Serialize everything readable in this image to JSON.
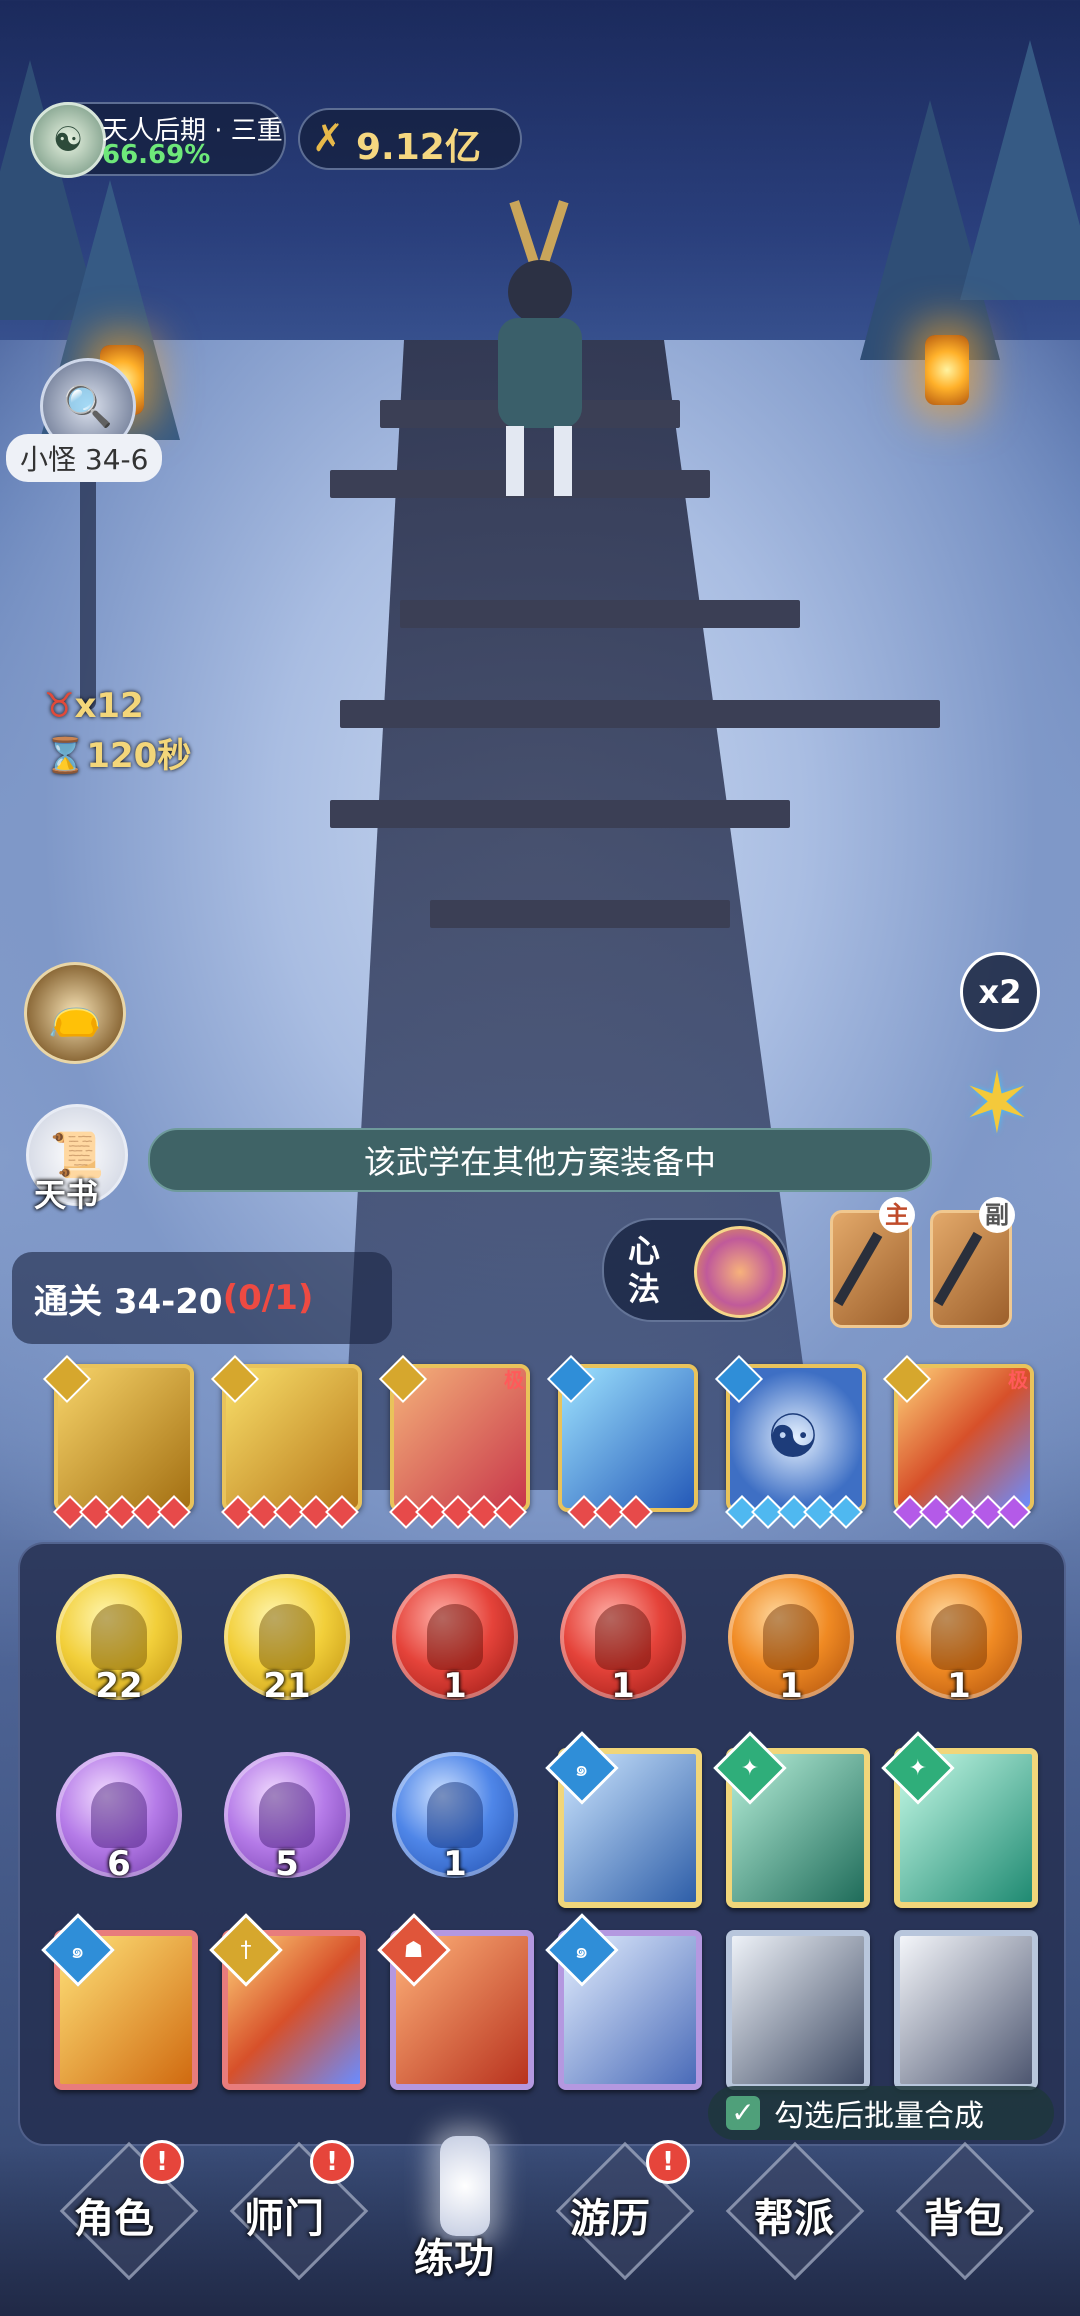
{
  "top": {
    "realm_label": "天人后期 · 三重",
    "realm_percent": "66.69%",
    "power_value": "9.12亿"
  },
  "left": {
    "search_label": "小怪 34-6",
    "enemy_count": "x12",
    "timer": "120秒",
    "tianshu_label": "天书"
  },
  "right": {
    "speed_label": "x2"
  },
  "banner_text": "该武学在其他方案装备中",
  "progress": {
    "label": "通关 34-20",
    "count": "(0/1)"
  },
  "xinfa": {
    "label": "心法"
  },
  "weapons": {
    "main_tag": "主",
    "sub_tag": "副"
  },
  "skill_cards": [
    {
      "tag": ""
    },
    {
      "tag": ""
    },
    {
      "tag": "极"
    },
    {
      "tag": ""
    },
    {
      "tag": ""
    },
    {
      "tag": "极"
    }
  ],
  "inventory": {
    "orbs": [
      {
        "count": "22",
        "color": "#f2cf3a"
      },
      {
        "count": "21",
        "color": "#f2cf3a"
      },
      {
        "count": "1",
        "color": "#e5433a"
      },
      {
        "count": "1",
        "color": "#e5433a"
      },
      {
        "count": "1",
        "color": "#f08a23"
      },
      {
        "count": "1",
        "color": "#f08a23"
      },
      {
        "count": "6",
        "color": "#b57be8"
      },
      {
        "count": "5",
        "color": "#b57be8"
      },
      {
        "count": "1",
        "color": "#4f86e8"
      }
    ],
    "batch_label": "勾选后批量合成"
  },
  "nav": {
    "items": [
      {
        "label": "角色",
        "alert": "!"
      },
      {
        "label": "师门",
        "alert": "!"
      },
      {
        "label": "练功",
        "alert": ""
      },
      {
        "label": "游历",
        "alert": "!"
      },
      {
        "label": "帮派",
        "alert": ""
      },
      {
        "label": "背包",
        "alert": ""
      }
    ]
  },
  "icons": [
    "realm-icon",
    "power-icon",
    "search-icon",
    "enemy-icon",
    "hourglass-icon",
    "pouch-icon",
    "scroll-icon",
    "speed-icon",
    "star-icon",
    "xinfa-orb-icon",
    "dagger-icon",
    "checkbox-icon"
  ]
}
